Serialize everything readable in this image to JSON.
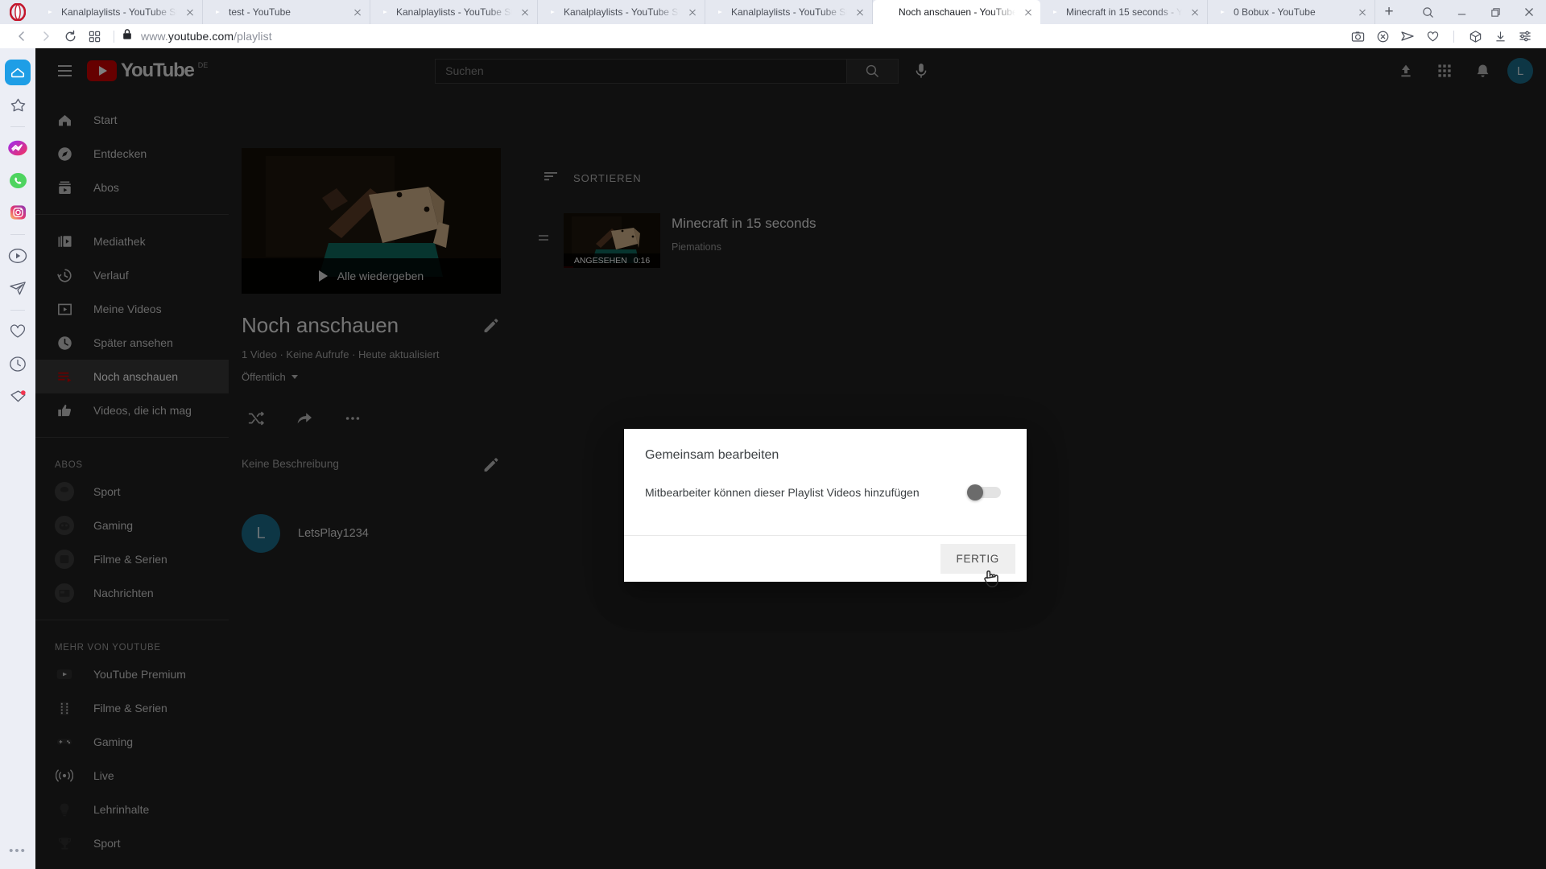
{
  "browser": {
    "name": "Opera",
    "tabs": [
      {
        "title": "Kanalplaylists - YouTube St",
        "favicon": "youtube-icon",
        "active": false
      },
      {
        "title": "test - YouTube",
        "favicon": "youtube-icon",
        "active": false
      },
      {
        "title": "Kanalplaylists - YouTube St",
        "favicon": "youtube-icon",
        "active": false
      },
      {
        "title": "Kanalplaylists - YouTube St",
        "favicon": "youtube-icon",
        "active": false
      },
      {
        "title": "Kanalplaylists - YouTube St",
        "favicon": "youtube-icon",
        "active": false
      },
      {
        "title": "Noch anschauen - YouTube",
        "favicon": "youtube-icon",
        "active": true
      },
      {
        "title": "Minecraft in 15 seconds - Y",
        "favicon": "youtube-icon",
        "active": false
      },
      {
        "title": "0 Bobux - YouTube",
        "favicon": "youtube-icon",
        "active": false
      }
    ],
    "new_tab_label": "+",
    "window_controls": [
      "search-icon",
      "minimize-icon",
      "maximize-icon",
      "close-icon"
    ],
    "address": {
      "prefix": "www.",
      "domain": "youtube.com",
      "path": "/playlist",
      "secure": true
    },
    "nav_buttons": [
      "back-icon",
      "forward-icon",
      "reload-icon",
      "tab-grid-icon"
    ],
    "toolbar_icons": [
      "snapshot-icon",
      "ad-block-icon",
      "send-icon",
      "heart-icon",
      "cube-icon",
      "download-icon",
      "easy-setup-icon"
    ],
    "sidebar_icons": [
      "home-icon",
      "favorites-star-icon",
      "messenger-icon",
      "whatsapp-icon",
      "instagram-icon",
      "player-icon",
      "telegram-icon",
      "heart-icon",
      "history-icon",
      "pinboard-icon",
      "more-dots-icon"
    ]
  },
  "youtube": {
    "header": {
      "menu_label": "menu-icon",
      "logo_text": "YouTube",
      "logo_country": "DE",
      "search_placeholder": "Suchen",
      "search_value": "",
      "icons": [
        "upload-icon",
        "apps-grid-icon",
        "notifications-bell-icon"
      ],
      "avatar_letter": "L"
    },
    "sidebar": {
      "primary": [
        {
          "label": "Start",
          "icon": "home-icon",
          "active": false
        },
        {
          "label": "Entdecken",
          "icon": "compass-icon",
          "active": false
        },
        {
          "label": "Abos",
          "icon": "subscriptions-icon",
          "active": false
        }
      ],
      "library": [
        {
          "label": "Mediathek",
          "icon": "library-icon",
          "active": false
        },
        {
          "label": "Verlauf",
          "icon": "history-icon",
          "active": false
        },
        {
          "label": "Meine Videos",
          "icon": "my-videos-icon",
          "active": false
        },
        {
          "label": "Später ansehen",
          "icon": "watch-later-icon",
          "active": false
        },
        {
          "label": "Noch anschauen",
          "icon": "playlist-icon",
          "active": true
        },
        {
          "label": "Videos, die ich mag",
          "icon": "thumbs-up-icon",
          "active": false
        }
      ],
      "subs_title": "ABOS",
      "subscriptions": [
        {
          "label": "Sport",
          "color": "#3d3d3d"
        },
        {
          "label": "Gaming",
          "color": "#3d3d3d"
        },
        {
          "label": "Filme & Serien",
          "color": "#3d3d3d"
        },
        {
          "label": "Nachrichten",
          "color": "#3d3d3d"
        }
      ],
      "more_title": "MEHR VON YOUTUBE",
      "more": [
        {
          "label": "YouTube Premium",
          "icon": "youtube-premium-icon"
        },
        {
          "label": "Filme & Serien",
          "icon": "film-icon"
        },
        {
          "label": "Gaming",
          "icon": "gamepad-icon"
        },
        {
          "label": "Live",
          "icon": "live-icon"
        },
        {
          "label": "Lehrinhalte",
          "icon": "bulb-icon"
        },
        {
          "label": "Sport",
          "icon": "trophy-icon"
        }
      ]
    },
    "playlist": {
      "play_all_label": "Alle wiedergeben",
      "title": "Noch anschauen",
      "meta": "1 Video · Keine Aufrufe · Heute aktualisiert",
      "privacy": "Öffentlich",
      "description": "Keine Beschreibung",
      "owner": "LetsPlay1234",
      "owner_initial": "L",
      "actions": [
        "shuffle-icon",
        "share-icon",
        "more-options-icon"
      ],
      "edit_title_icon": "pencil-icon",
      "edit_description_icon": "pencil-icon"
    },
    "video_list": {
      "sort_label": "SORTIEREN",
      "sort_icon": "sort-icon",
      "items": [
        {
          "title": "Minecraft in 15 seconds",
          "channel": "Piemations",
          "badge": "ANGESEHEN",
          "duration": "0:16"
        }
      ]
    }
  },
  "modal": {
    "title": "Gemeinsam bearbeiten",
    "toggle_label": "Mitbearbeiter können dieser Playlist Videos hinzufügen",
    "toggle_on": false,
    "done_label": "FERTIG"
  },
  "colors": {
    "yt_red": "#cc0000",
    "opera_red": "#c4162c",
    "accent_blue": "#1e9ee6",
    "avatar_teal": "#1b6d8a",
    "yt_bg": "#212121"
  }
}
